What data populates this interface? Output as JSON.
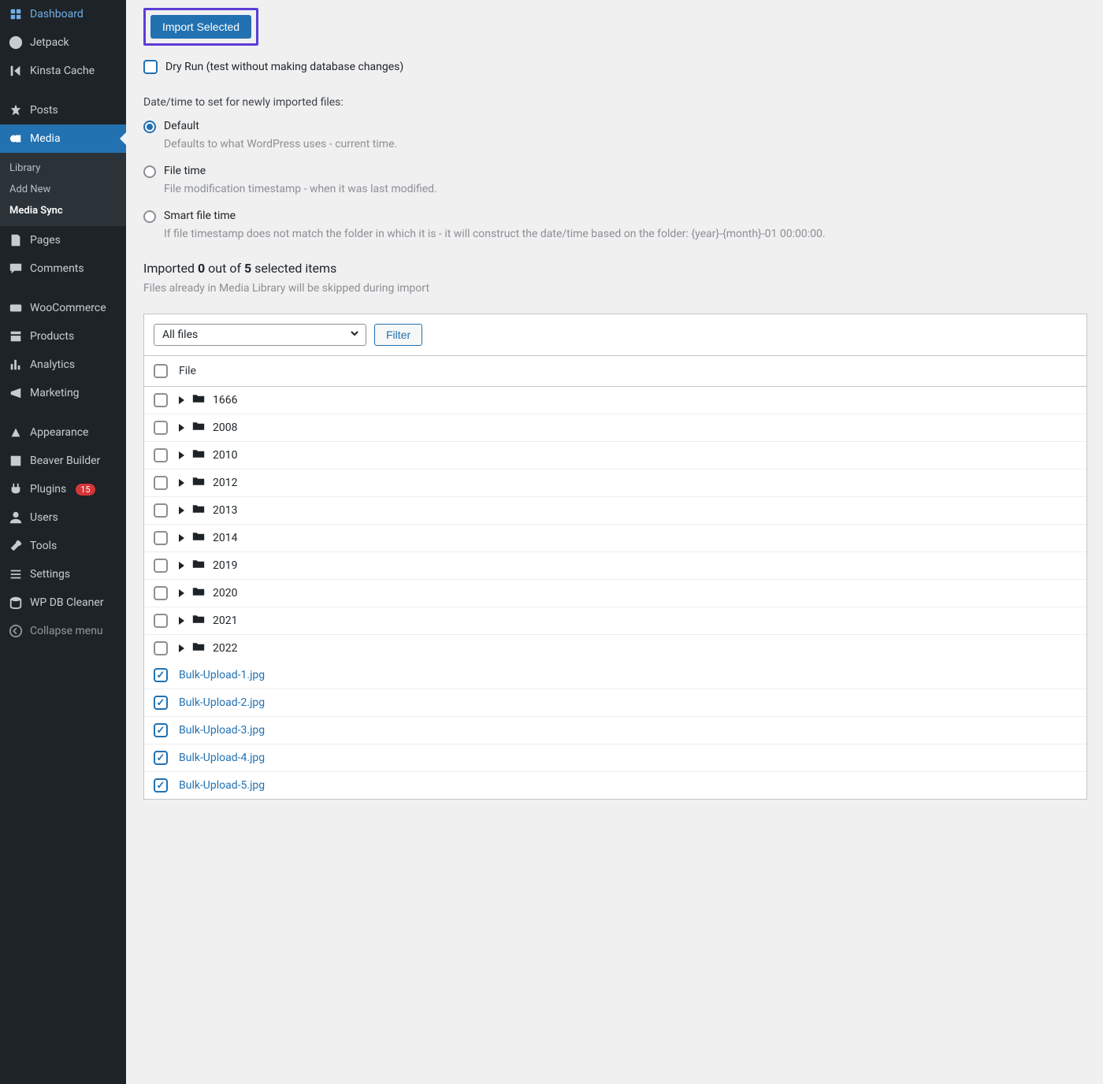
{
  "sidebar": {
    "items": [
      {
        "label": "Dashboard",
        "icon": "dashboard-icon"
      },
      {
        "label": "Jetpack",
        "icon": "jetpack-icon"
      },
      {
        "label": "Kinsta Cache",
        "icon": "kinsta-icon"
      },
      {
        "label": "Posts",
        "icon": "pin-icon"
      },
      {
        "label": "Media",
        "icon": "media-icon",
        "active": true
      },
      {
        "label": "Pages",
        "icon": "pages-icon"
      },
      {
        "label": "Comments",
        "icon": "comments-icon"
      },
      {
        "label": "WooCommerce",
        "icon": "woo-icon"
      },
      {
        "label": "Products",
        "icon": "products-icon"
      },
      {
        "label": "Analytics",
        "icon": "analytics-icon"
      },
      {
        "label": "Marketing",
        "icon": "marketing-icon"
      },
      {
        "label": "Appearance",
        "icon": "appearance-icon"
      },
      {
        "label": "Beaver Builder",
        "icon": "beaver-icon"
      },
      {
        "label": "Plugins",
        "icon": "plugins-icon",
        "badge": "15"
      },
      {
        "label": "Users",
        "icon": "users-icon"
      },
      {
        "label": "Tools",
        "icon": "tools-icon"
      },
      {
        "label": "Settings",
        "icon": "settings-icon"
      },
      {
        "label": "WP DB Cleaner",
        "icon": "db-icon"
      },
      {
        "label": "Collapse menu",
        "icon": "collapse-icon"
      }
    ],
    "sub": [
      {
        "label": "Library"
      },
      {
        "label": "Add New"
      },
      {
        "label": "Media Sync",
        "current": true
      }
    ]
  },
  "actions": {
    "import_button": "Import Selected",
    "dry_run_label": "Dry Run (test without making database changes)",
    "filter_button": "Filter",
    "filter_select": "All files"
  },
  "datetime": {
    "section_label": "Date/time to set for newly imported files:",
    "options": [
      {
        "label": "Default",
        "desc": "Defaults to what WordPress uses - current time.",
        "selected": true
      },
      {
        "label": "File time",
        "desc": "File modification timestamp - when it was last modified."
      },
      {
        "label": "Smart file time",
        "desc": "If file timestamp does not match the folder in which it is - it will construct the date/time based on the folder: {year}-{month}-01 00:00:00."
      }
    ]
  },
  "status": {
    "prefix": "Imported ",
    "imported_count": "0",
    "middle": " out of ",
    "selected_count": "5",
    "suffix": " selected items",
    "hint": "Files already in Media Library will be skipped during import"
  },
  "table": {
    "header": "File",
    "folders": [
      "1666",
      "2008",
      "2010",
      "2012",
      "2013",
      "2014",
      "2019",
      "2020",
      "2021",
      "2022"
    ],
    "files": [
      "Bulk-Upload-1.jpg",
      "Bulk-Upload-2.jpg",
      "Bulk-Upload-3.jpg",
      "Bulk-Upload-4.jpg",
      "Bulk-Upload-5.jpg"
    ]
  }
}
